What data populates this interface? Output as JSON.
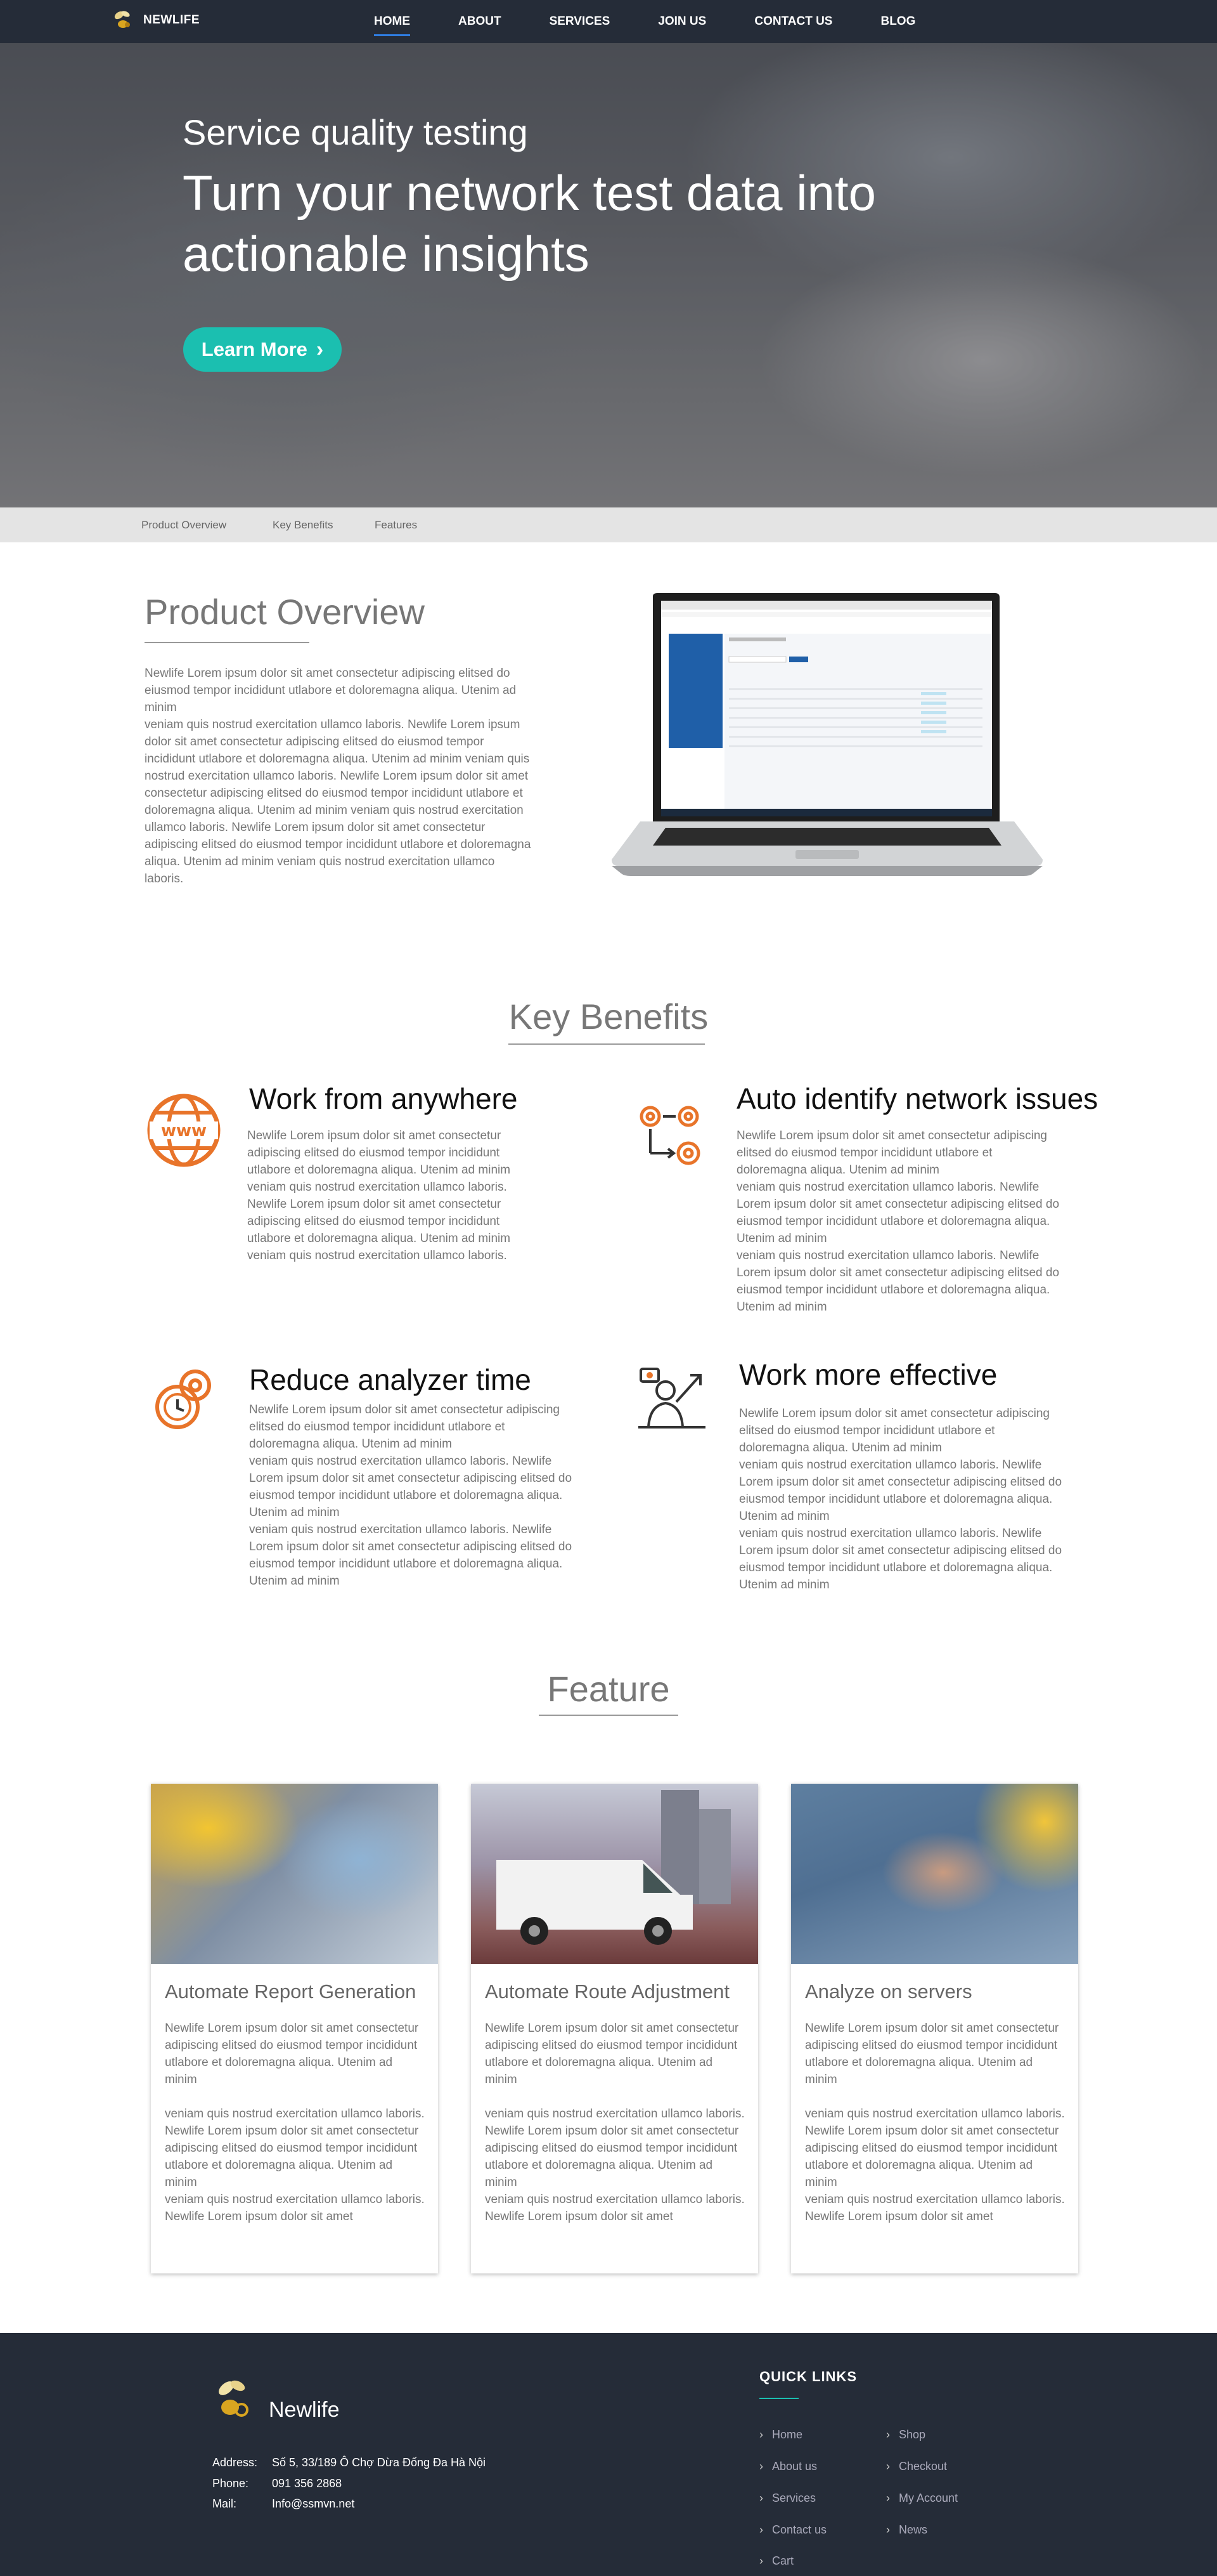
{
  "nav": {
    "brand": "NEWLIFE",
    "items": [
      {
        "label": "HOME",
        "active": true
      },
      {
        "label": "ABOUT"
      },
      {
        "label": "SERVICES"
      },
      {
        "label": "JOIN US"
      },
      {
        "label": "CONTACT US"
      },
      {
        "label": "BLOG"
      }
    ]
  },
  "hero": {
    "subtitle": "Service quality testing",
    "title": "Turn your network test data into actionable insights",
    "button": "Learn More",
    "button_icon": "chevron-right-icon"
  },
  "subnav": [
    "Product Overview",
    "Key Benefits",
    "Features"
  ],
  "overview": {
    "title": "Product Overview",
    "text": "Newlife Lorem ipsum dolor sit amet consectetur adipiscing elitsed do eiusmod tempor incididunt utlabore et doloremagna aliqua. Utenim ad minim\nveniam quis nostrud exercitation ullamco laboris. Newlife Lorem ipsum dolor sit amet consectetur adipiscing elitsed do eiusmod tempor incididunt utlabore et doloremagna aliqua. Utenim ad minim veniam quis nostrud exercitation ullamco laboris. Newlife Lorem ipsum dolor sit amet consectetur adipiscing elitsed do eiusmod tempor incididunt utlabore et doloremagna aliqua. Utenim ad minim veniam quis nostrud exercitation ullamco laboris. Newlife Lorem ipsum dolor sit amet consectetur adipiscing elitsed do eiusmod tempor incididunt utlabore et doloremagna aliqua. Utenim ad minim veniam quis nostrud exercitation ullamco laboris."
  },
  "benefits": {
    "title": "Key Benefits",
    "items": [
      {
        "title": "Work from anywhere",
        "icon": "globe-www-icon",
        "text": "Newlife Lorem ipsum dolor sit amet consectetur adipiscing elitsed do eiusmod tempor incididunt utlabore et doloremagna aliqua. Utenim ad minim veniam quis nostrud exercitation ullamco laboris. Newlife Lorem ipsum dolor sit amet consectetur adipiscing elitsed do eiusmod tempor incididunt utlabore et doloremagna aliqua. Utenim ad minim veniam quis nostrud exercitation ullamco laboris."
      },
      {
        "title": "Auto identify network issues",
        "icon": "gears-flow-icon",
        "text": "Newlife Lorem ipsum dolor sit amet consectetur adipiscing elitsed do eiusmod tempor incididunt utlabore et doloremagna aliqua. Utenim ad minim\nveniam quis nostrud exercitation ullamco laboris. Newlife Lorem ipsum dolor sit amet consectetur adipiscing elitsed do eiusmod tempor incididunt utlabore et doloremagna aliqua. Utenim ad minim\nveniam quis nostrud exercitation ullamco laboris. Newlife Lorem ipsum dolor sit amet consectetur adipiscing elitsed do eiusmod tempor incididunt utlabore et doloremagna aliqua. Utenim ad minim"
      },
      {
        "title": "Reduce analyzer time",
        "icon": "gear-clock-icon",
        "text": "Newlife Lorem ipsum dolor sit amet consectetur adipiscing elitsed do eiusmod tempor incididunt utlabore et doloremagna aliqua. Utenim ad minim\nveniam quis nostrud exercitation ullamco laboris. Newlife Lorem ipsum dolor sit amet consectetur adipiscing elitsed do eiusmod tempor incididunt utlabore et doloremagna aliqua. Utenim ad minim\nveniam quis nostrud exercitation ullamco laboris. Newlife Lorem ipsum dolor sit amet consectetur adipiscing elitsed do eiusmod tempor incididunt utlabore et doloremagna aliqua. Utenim ad minim"
      },
      {
        "title": "Work more effective",
        "icon": "businessman-growth-icon",
        "text": "Newlife Lorem ipsum dolor sit amet consectetur adipiscing elitsed do eiusmod tempor incididunt utlabore et doloremagna aliqua. Utenim ad minim\nveniam quis nostrud exercitation ullamco laboris. Newlife Lorem ipsum dolor sit amet consectetur adipiscing elitsed do eiusmod tempor incididunt utlabore et doloremagna aliqua. Utenim ad minim\nveniam quis nostrud exercitation ullamco laboris. Newlife Lorem ipsum dolor sit amet consectetur adipiscing elitsed do eiusmod tempor incididunt utlabore et doloremagna aliqua. Utenim ad minim"
      }
    ]
  },
  "features": {
    "title": "Feature",
    "cards": [
      {
        "title": "Automate Report Generation",
        "text": "Newlife Lorem ipsum dolor sit amet consectetur adipiscing elitsed do eiusmod tempor incididunt utlabore et doloremagna aliqua. Utenim ad minim\n\nveniam quis nostrud exercitation ullamco laboris. Newlife Lorem ipsum dolor sit amet consectetur adipiscing elitsed do eiusmod tempor incididunt utlabore et doloremagna aliqua. Utenim ad minim\nveniam quis nostrud exercitation ullamco laboris. Newlife Lorem ipsum dolor sit amet"
      },
      {
        "title": "Automate Route Adjustment",
        "text": "Newlife Lorem ipsum dolor sit amet consectetur adipiscing elitsed do eiusmod tempor incididunt utlabore et doloremagna aliqua. Utenim ad minim\n\nveniam quis nostrud exercitation ullamco laboris. Newlife Lorem ipsum dolor sit amet consectetur adipiscing elitsed do eiusmod tempor incididunt utlabore et doloremagna aliqua. Utenim ad minim\nveniam quis nostrud exercitation ullamco laboris. Newlife Lorem ipsum dolor sit amet"
      },
      {
        "title": "Analyze on servers",
        "text": "Newlife Lorem ipsum dolor sit amet consectetur adipiscing elitsed do eiusmod tempor incididunt utlabore et doloremagna aliqua. Utenim ad minim\n\nveniam quis nostrud exercitation ullamco laboris. Newlife Lorem ipsum dolor sit amet consectetur adipiscing elitsed do eiusmod tempor incididunt utlabore et doloremagna aliqua. Utenim ad minim\nveniam quis nostrud exercitation ullamco laboris. Newlife Lorem ipsum dolor sit amet"
      }
    ]
  },
  "footer": {
    "brand": "Newlife",
    "address_label": "Address:",
    "address": "Số 5, 33/189 Ô Chợ Dừa Đống Đa Hà Nội",
    "phone_label": "Phone:",
    "phone": "091 356 2868",
    "mail_label": "Mail:",
    "mail": "Info@ssmvn.net",
    "quick_links_title": "QUICK LINKS",
    "links_left": [
      "Home",
      "About us",
      "Services",
      "Contact us",
      "Cart"
    ],
    "links_right": [
      "Shop",
      "Checkout",
      "My Account",
      "News"
    ]
  },
  "colors": {
    "accent": "#1bbfb0",
    "nav_bg": "#252c38",
    "icon_orange": "#e8742a",
    "active_underline": "#2f7de1"
  }
}
